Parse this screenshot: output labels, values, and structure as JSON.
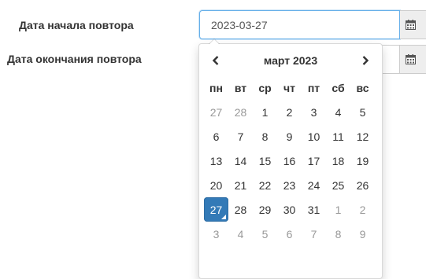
{
  "form": {
    "start_label": "Дата начала повтора",
    "start_value": "2023-03-27",
    "end_label": "Дата окончания повтора",
    "end_value": ""
  },
  "icons": {
    "addon": "calendar-icon",
    "prev": "chevron-left-icon",
    "next": "chevron-right-icon"
  },
  "colors": {
    "selected": "#337ab7",
    "muted_day": "#999999",
    "focus_border": "#66afe9"
  },
  "datepicker": {
    "title": "март 2023",
    "weekdays": [
      "пн",
      "вт",
      "ср",
      "чт",
      "пт",
      "сб",
      "вс"
    ],
    "weeks": [
      [
        {
          "d": "27",
          "muted": true
        },
        {
          "d": "28",
          "muted": true
        },
        {
          "d": "1"
        },
        {
          "d": "2"
        },
        {
          "d": "3"
        },
        {
          "d": "4"
        },
        {
          "d": "5"
        }
      ],
      [
        {
          "d": "6"
        },
        {
          "d": "7"
        },
        {
          "d": "8"
        },
        {
          "d": "9"
        },
        {
          "d": "10"
        },
        {
          "d": "11"
        },
        {
          "d": "12"
        }
      ],
      [
        {
          "d": "13"
        },
        {
          "d": "14"
        },
        {
          "d": "15"
        },
        {
          "d": "16"
        },
        {
          "d": "17"
        },
        {
          "d": "18"
        },
        {
          "d": "19"
        }
      ],
      [
        {
          "d": "20"
        },
        {
          "d": "21"
        },
        {
          "d": "22"
        },
        {
          "d": "23"
        },
        {
          "d": "24"
        },
        {
          "d": "25"
        },
        {
          "d": "26"
        }
      ],
      [
        {
          "d": "27",
          "selected": true
        },
        {
          "d": "28"
        },
        {
          "d": "29"
        },
        {
          "d": "30"
        },
        {
          "d": "31"
        },
        {
          "d": "1",
          "muted": true
        },
        {
          "d": "2",
          "muted": true
        }
      ],
      [
        {
          "d": "3",
          "muted": true
        },
        {
          "d": "4",
          "muted": true
        },
        {
          "d": "5",
          "muted": true
        },
        {
          "d": "6",
          "muted": true
        },
        {
          "d": "7",
          "muted": true
        },
        {
          "d": "8",
          "muted": true
        },
        {
          "d": "9",
          "muted": true
        }
      ]
    ]
  }
}
